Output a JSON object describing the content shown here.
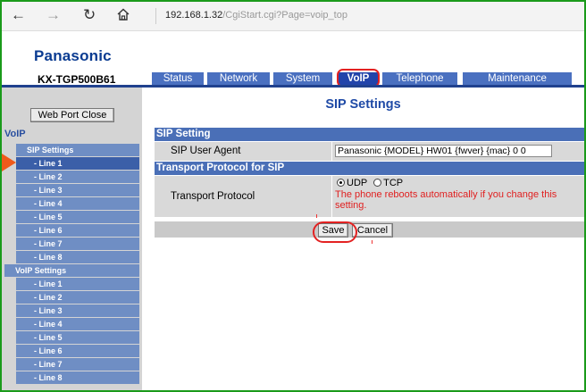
{
  "browser": {
    "back_icon": "arrow-left-icon",
    "forward_icon": "arrow-right-icon",
    "refresh_icon": "refresh-icon",
    "home_icon": "home-icon",
    "url_host": "192.168.1.32",
    "url_path": "/CgiStart.cgi?Page=voip_top"
  },
  "header": {
    "brand": "Panasonic",
    "model": "KX-TGP500B61",
    "tabs": [
      {
        "label": "Status",
        "active": false
      },
      {
        "label": "Network",
        "active": false
      },
      {
        "label": "System",
        "active": false
      },
      {
        "label": "VoIP",
        "active": true
      },
      {
        "label": "Telephone",
        "active": false
      },
      {
        "label": "Maintenance",
        "active": false
      }
    ]
  },
  "sidebar": {
    "web_port_close": "Web Port Close",
    "section": "VoIP",
    "sip_group": "SIP Settings",
    "sip_lines": [
      "- Line 1",
      "- Line 2",
      "- Line 3",
      "- Line 4",
      "- Line 5",
      "- Line 6",
      "- Line 7",
      "- Line 8"
    ],
    "voip_group": "VoIP Settings",
    "voip_lines": [
      "- Line 1",
      "- Line 2",
      "- Line 3",
      "- Line 4",
      "- Line 5",
      "- Line 6",
      "- Line 7",
      "- Line 8"
    ]
  },
  "main": {
    "title": "SIP Settings",
    "sip_setting_header": "SIP Setting",
    "user_agent_label": "SIP User Agent",
    "user_agent_value": "Panasonic {MODEL} HW01 {fwver} {mac} 0 0",
    "transport_header": "Transport Protocol for SIP",
    "transport_label": "Transport Protocol",
    "udp_label": "UDP",
    "tcp_label": "TCP",
    "selected_protocol": "UDP",
    "warning": "The phone reboots automatically if you change this setting.",
    "save_label": "Save",
    "cancel_label": "Cancel"
  },
  "colors": {
    "accent_blue": "#4a6fb7",
    "annotation_red": "#e32222",
    "arrow_orange": "#ef5a1a",
    "frame_green": "#1a9a1a"
  }
}
